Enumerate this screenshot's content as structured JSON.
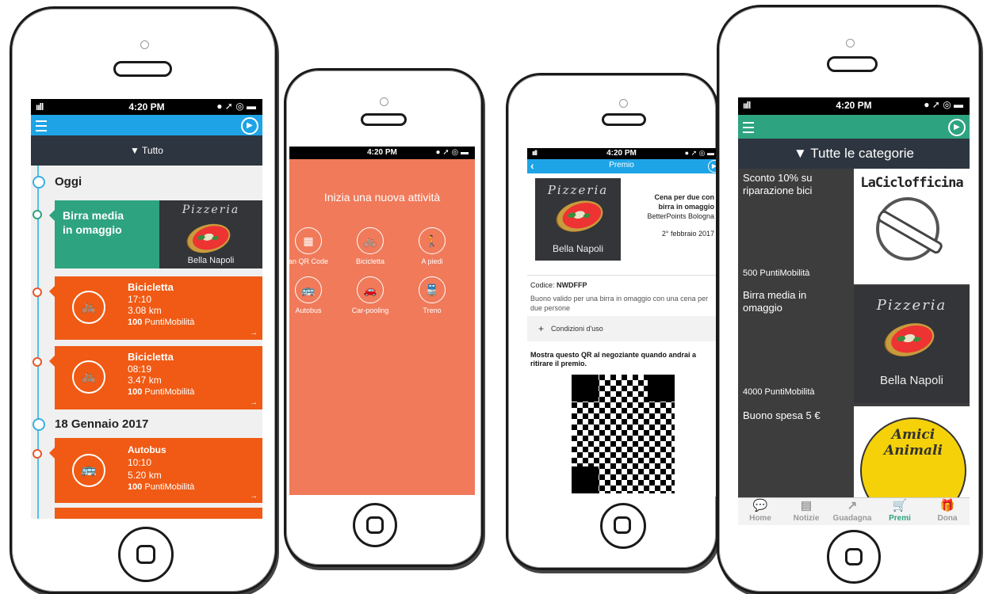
{
  "status": {
    "time": "4:20 PM",
    "signal": "ııll",
    "indicators": "● ➚ ◎ ▬"
  },
  "phone1": {
    "filter_label": "▼ Tutto",
    "sections": [
      {
        "title": "Oggi"
      },
      {
        "title": "18 Gennaio 2017"
      }
    ],
    "promo": {
      "title_line1": "Birra media",
      "title_line2": "in omaggio"
    },
    "activities": [
      {
        "name": "Bicicletta",
        "time": "17:10",
        "distance": "3.08 km",
        "points": "100",
        "unit": "PuntiMobilità"
      },
      {
        "name": "Bicicletta",
        "time": "08:19",
        "distance": "3.47 km",
        "points": "100",
        "unit": "PuntiMobilità"
      },
      {
        "name": "Autobus",
        "time": "10:10",
        "distance": "5.20 km",
        "points": "100",
        "unit": "PuntiMobilità"
      }
    ]
  },
  "pizzeria": {
    "logo": "Pizzeria",
    "name": "Bella Napoli"
  },
  "phone2": {
    "heading": "Inizia una nuova attività",
    "items": [
      {
        "label": "an QR Code",
        "icon": "qr-code-icon"
      },
      {
        "label": "Bicicletta",
        "icon": "bicycle-icon"
      },
      {
        "label": "A piedi",
        "icon": "walk-icon"
      },
      {
        "label": "Autobus",
        "icon": "bus-icon"
      },
      {
        "label": "Car-pooling",
        "icon": "car-icon"
      },
      {
        "label": "Treno",
        "icon": "train-icon"
      }
    ]
  },
  "phone3": {
    "title": "Premio",
    "prize_line1": "Cena per due con",
    "prize_line2": "birra in omaggio",
    "sponsor": "BetterPoints Bologna",
    "date": "2° febbraio 2017",
    "code_label": "Codice: ",
    "code": "NWDFFP",
    "description": "Buono valido per una birra in omaggio con una cena per due persone",
    "conditions": "Condizioni d'uso",
    "qr_instruction": "Mostra questo QR al negoziante quando andrai a ritirare il premio."
  },
  "phone4": {
    "filter_label": "▼ Tutte le categorie",
    "prizes": [
      {
        "title": "Sconto 10% su riparazione bici",
        "points": "500 PuntiMobilità",
        "brand": "LaCiclofficina"
      },
      {
        "title": "Birra media in omaggio",
        "points": "4000 PuntiMobilità",
        "brand": "Bella Napoli"
      },
      {
        "title": "Buono spesa 5 €",
        "points": "",
        "brand_line1": "Amici",
        "brand_line2": "Animali"
      }
    ],
    "tabs": [
      {
        "label": "Home",
        "icon": "chat-icon"
      },
      {
        "label": "Notizie",
        "icon": "news-icon"
      },
      {
        "label": "Guadagna",
        "icon": "trend-icon"
      },
      {
        "label": "Premi",
        "icon": "cart-icon"
      },
      {
        "label": "Dona",
        "icon": "gift-icon"
      }
    ]
  },
  "colors": {
    "orange": "#f05a14",
    "teal": "#2ea37f",
    "blue": "#1ea4e6",
    "salmon": "#f07a5a",
    "dark": "#2d3640"
  }
}
